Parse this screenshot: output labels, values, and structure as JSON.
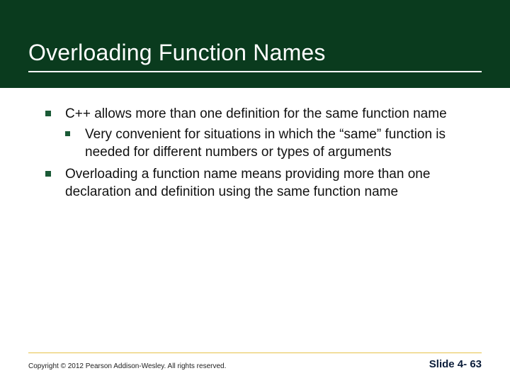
{
  "header": {
    "title": "Overloading Function Names"
  },
  "bullets": [
    {
      "text": "C++ allows more than one definition for the same function name",
      "sub": [
        {
          "text": "Very convenient for situations in which the “same” function is needed for different numbers or types of arguments"
        }
      ]
    },
    {
      "text": "Overloading a function name means providing more than one declaration and definition using the same function name",
      "sub": []
    }
  ],
  "footer": {
    "copyright": "Copyright © 2012 Pearson Addison-Wesley. All rights reserved.",
    "slide": "Slide 4- 63"
  }
}
